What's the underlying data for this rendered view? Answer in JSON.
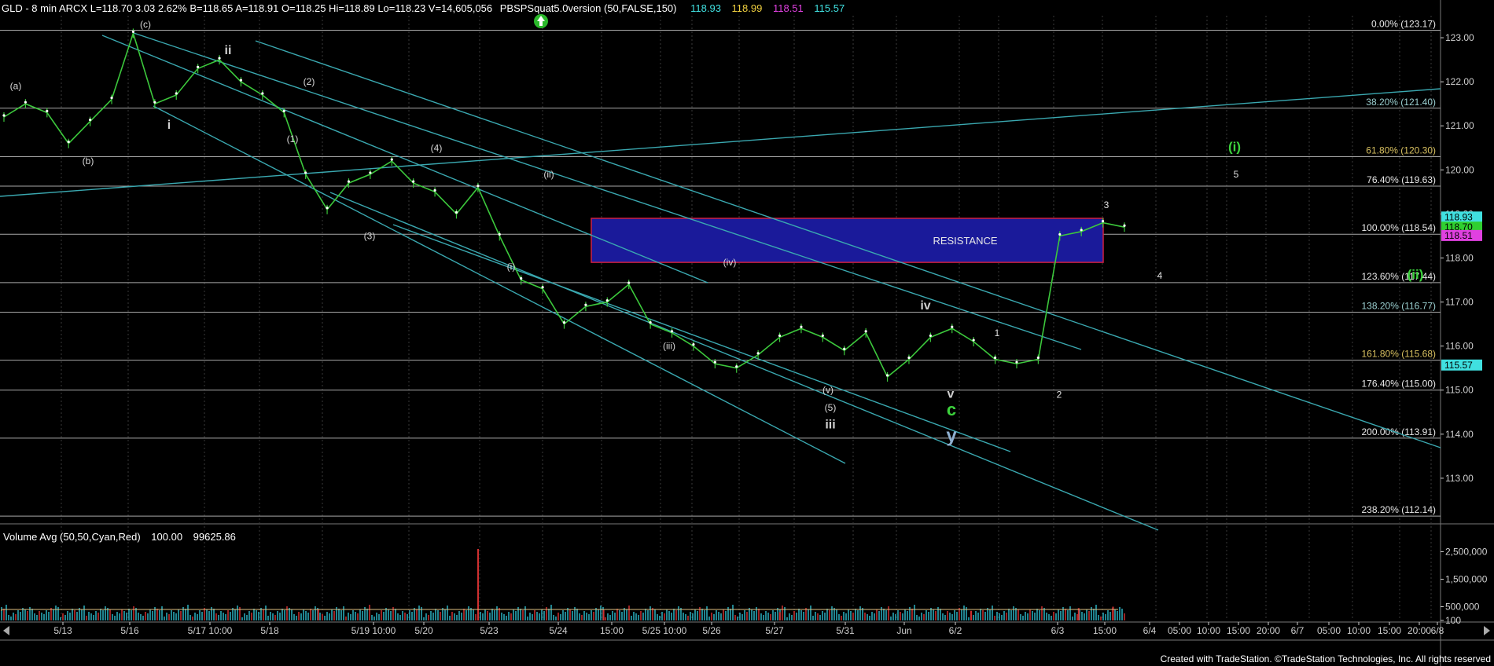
{
  "header": {
    "symbol_text": "GLD - 8 min  ARCX  L=118.70  3.03  2.62%  B=118.65  A=118.91  O=118.25  Hi=118.89  Lo=118.23  V=14,605,056",
    "indicator_text": "PBSPSquat5.0version (50,FALSE,150)",
    "indicator_values": [
      {
        "text": "118.93",
        "color": "#40e0e0"
      },
      {
        "text": "118.99",
        "color": "#f0d040"
      },
      {
        "text": "118.51",
        "color": "#e040e0"
      },
      {
        "text": "115.57",
        "color": "#40e0e0"
      }
    ]
  },
  "volume_header": {
    "text": "Volume Avg (50,50,Cyan,Red)",
    "value1": "100.00",
    "value2": "99625.86"
  },
  "credit": "Created with TradeStation. ©TradeStation Technologies, Inc. All rights reserved",
  "colors": {
    "background": "#000000",
    "price": "#3cc83c",
    "trendline": "#3aa8b0",
    "fib_line": "#a8a8a8",
    "resistance_fill": "#1a1a9a",
    "resistance_border": "#d02040",
    "label": "#d8d8d8",
    "green_label": "#3cd23c",
    "axis": "#cfcfcf"
  },
  "chart_data": {
    "type": "line",
    "title": "GLD - 8 min",
    "y_axis": {
      "ticks": [
        "123.00",
        "122.00",
        "121.00",
        "120.00",
        "119.00",
        "118.00",
        "117.00",
        "116.00",
        "115.00",
        "114.00",
        "113.00"
      ],
      "ylim": [
        112.0,
        123.5
      ]
    },
    "x_axis": {
      "ticks": [
        "5/13",
        "5/16",
        "5/17 10:00",
        "5/18",
        "5/19 10:00",
        "5/20",
        "5/23",
        "5/24",
        "15:00",
        "5/25 10:00",
        "5/26",
        "5/27",
        "5/31",
        "Jun",
        "6/2",
        "6/3",
        "15:00",
        "6/4",
        "05:00",
        "10:00",
        "15:00",
        "20:00",
        "6/7",
        "05:00",
        "10:00",
        "15:00",
        "20:00",
        "6/8"
      ]
    },
    "price_series": {
      "name": "GLD",
      "x_index": [
        0,
        4,
        8,
        12,
        16,
        20,
        24,
        28,
        32,
        36,
        40,
        44,
        48,
        52,
        56,
        60,
        64,
        68,
        72,
        76,
        80,
        84,
        88,
        92,
        96,
        100,
        104,
        108,
        112,
        116,
        120,
        124,
        128,
        132,
        136,
        140,
        144,
        148,
        152,
        156,
        160,
        164,
        168,
        172,
        176,
        180,
        184,
        188,
        192,
        196,
        200,
        204,
        208
      ],
      "values": [
        121.2,
        121.5,
        121.3,
        120.6,
        121.1,
        121.6,
        123.1,
        121.5,
        121.7,
        122.3,
        122.5,
        122.0,
        121.7,
        121.3,
        119.9,
        119.1,
        119.7,
        119.9,
        120.2,
        119.7,
        119.5,
        119.0,
        119.6,
        118.5,
        117.5,
        117.3,
        116.5,
        116.9,
        117.0,
        117.4,
        116.5,
        116.3,
        116.0,
        115.6,
        115.5,
        115.8,
        116.2,
        116.4,
        116.2,
        115.9,
        116.3,
        115.3,
        115.7,
        116.2,
        116.4,
        116.1,
        115.7,
        115.6,
        115.7,
        118.5,
        118.6,
        118.8,
        118.7
      ]
    },
    "volume_axis": {
      "ticks": [
        "2,500,000",
        "1,500,000",
        "500,000",
        "100"
      ]
    },
    "volume_spikes": [
      {
        "x": 0.32,
        "value": 2600000
      },
      {
        "x": 0.213,
        "value": 420000
      },
      {
        "x": 0.404,
        "value": 380000
      },
      {
        "x": 0.522,
        "value": 300000
      },
      {
        "x": 0.65,
        "value": 350000
      },
      {
        "x": 0.722,
        "value": 450000
      },
      {
        "x": 0.745,
        "value": 500000
      }
    ],
    "fib_levels": [
      {
        "pct": "0.00%",
        "value": 123.17,
        "label": "0.00% (123.17)"
      },
      {
        "pct": "38.20%",
        "value": 121.4,
        "label": "38.20% (121.40)"
      },
      {
        "pct": "61.80%",
        "value": 120.3,
        "label": "61.80% (120.30)"
      },
      {
        "pct": "76.40%",
        "value": 119.63,
        "label": "76.40% (119.63)"
      },
      {
        "pct": "100.00%",
        "value": 118.54,
        "label": "100.00% (118.54)"
      },
      {
        "pct": "123.60%",
        "value": 117.44,
        "label": "123.60% (117.44)"
      },
      {
        "pct": "138.20%",
        "value": 116.77,
        "label": "138.20% (116.77)"
      },
      {
        "pct": "161.80%",
        "value": 115.68,
        "label": "161.80% (115.68)"
      },
      {
        "pct": "176.40%",
        "value": 115.0,
        "label": "176.40% (115.00)"
      },
      {
        "pct": "200.00%",
        "value": 113.91,
        "label": "200.00% (113.91)"
      },
      {
        "pct": "238.20%",
        "value": 112.14,
        "label": "238.20% (112.14)"
      }
    ],
    "resistance_box": {
      "label": "RESISTANCE",
      "low": 117.9,
      "high": 118.9
    },
    "price_markers": [
      {
        "text": "118.93",
        "value": 118.93,
        "color": "#40e0e0"
      },
      {
        "text": "118.70",
        "value": 118.7,
        "color": "#30d030"
      },
      {
        "text": "118.51",
        "value": 118.51,
        "color": "#e040e0"
      },
      {
        "text": "115.57",
        "value": 115.57,
        "color": "#40e0e0"
      }
    ],
    "wave_labels": [
      {
        "text": "(a)",
        "value": 121.9,
        "kind": "paren"
      },
      {
        "text": "(c)",
        "value": 123.3,
        "kind": "paren"
      },
      {
        "text": "ii",
        "value": 122.7,
        "kind": "roman"
      },
      {
        "text": "i",
        "value": 121.0,
        "kind": "roman"
      },
      {
        "text": "(b)",
        "value": 120.2,
        "kind": "paren"
      },
      {
        "text": "(2)",
        "value": 122.0,
        "kind": "paren"
      },
      {
        "text": "(1)",
        "value": 120.7,
        "kind": "paren"
      },
      {
        "text": "(4)",
        "value": 120.5,
        "kind": "paren"
      },
      {
        "text": "(3)",
        "value": 118.5,
        "kind": "paren"
      },
      {
        "text": "(ii)",
        "value": 119.9,
        "kind": "paren"
      },
      {
        "text": "(i)",
        "value": 117.8,
        "kind": "paren"
      },
      {
        "text": "(iv)",
        "value": 117.9,
        "kind": "paren"
      },
      {
        "text": "(iii)",
        "value": 116.0,
        "kind": "paren"
      },
      {
        "text": "(v)",
        "value": 115.0,
        "kind": "paren"
      },
      {
        "text": "(5)",
        "value": 114.6,
        "kind": "paren"
      },
      {
        "text": "iii",
        "value": 114.2,
        "kind": "roman"
      },
      {
        "text": "iv",
        "value": 116.9,
        "kind": "roman"
      },
      {
        "text": "v",
        "value": 114.9,
        "kind": "roman"
      },
      {
        "text": "c",
        "value": 114.5,
        "kind": "green"
      },
      {
        "text": "y",
        "value": 113.9,
        "kind": "bigroman"
      },
      {
        "text": "1",
        "value": 116.3,
        "kind": "num"
      },
      {
        "text": "2",
        "value": 114.9,
        "kind": "num"
      },
      {
        "text": "3",
        "value": 119.2,
        "kind": "num"
      },
      {
        "text": "4",
        "value": 117.6,
        "kind": "num"
      },
      {
        "text": "5",
        "value": 119.9,
        "kind": "num"
      },
      {
        "text": "(i)",
        "value": 120.5,
        "kind": "green"
      },
      {
        "text": "(ii)",
        "value": 117.6,
        "kind": "green"
      }
    ]
  }
}
